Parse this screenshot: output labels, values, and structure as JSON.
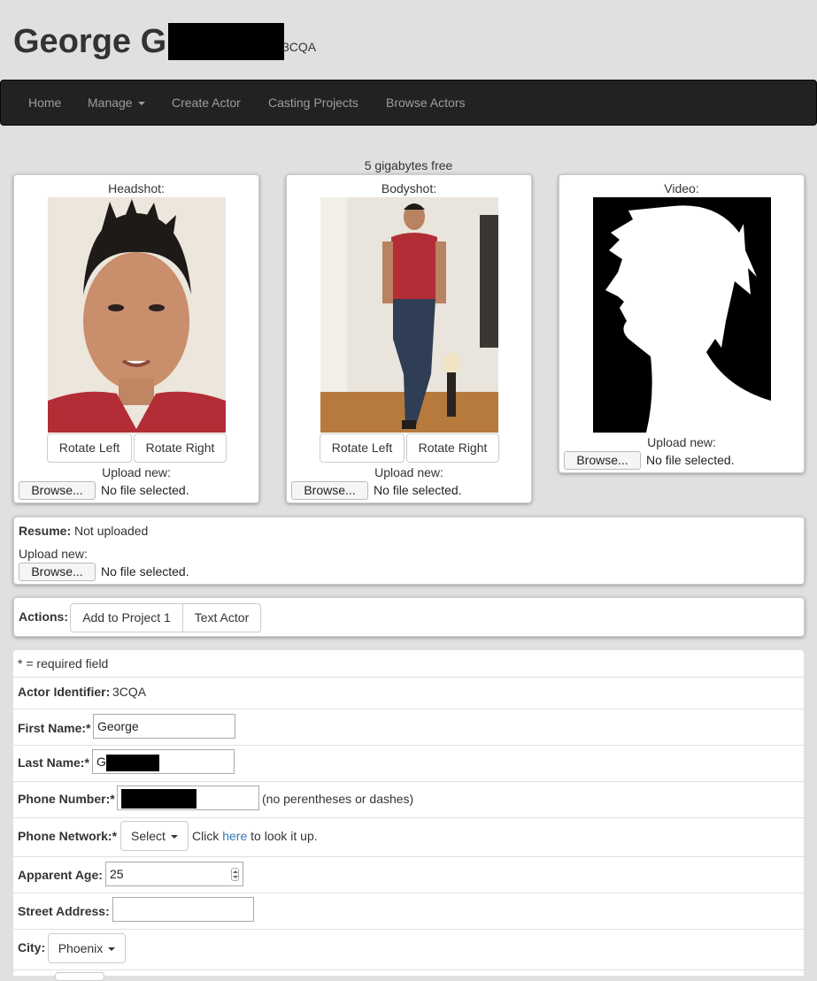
{
  "header": {
    "title_visible": "George G",
    "actor_code": "3CQA"
  },
  "nav": {
    "items": [
      {
        "label": "Home"
      },
      {
        "label": "Manage"
      },
      {
        "label": "Create Actor"
      },
      {
        "label": "Casting Projects"
      },
      {
        "label": "Browse Actors"
      }
    ]
  },
  "storage_text": "5 gigabytes free",
  "media": {
    "headshot": {
      "label": "Headshot:",
      "rotate_left": "Rotate Left",
      "rotate_right": "Rotate Right",
      "upload_label": "Upload new:",
      "browse": "Browse...",
      "file_status": "No file selected."
    },
    "bodyshot": {
      "label": "Bodyshot:",
      "rotate_left": "Rotate Left",
      "rotate_right": "Rotate Right",
      "upload_label": "Upload new:",
      "browse": "Browse...",
      "file_status": "No file selected."
    },
    "video": {
      "label": "Video:",
      "upload_label": "Upload new:",
      "browse": "Browse...",
      "file_status": "No file selected."
    }
  },
  "resume": {
    "label": "Resume:",
    "status": "Not uploaded",
    "upload_label": "Upload new:",
    "browse": "Browse...",
    "file_status": "No file selected."
  },
  "actions": {
    "label": "Actions:",
    "add_to_project": "Add to Project 1",
    "text_actor": "Text Actor"
  },
  "form": {
    "required_note": "* = required field",
    "identifier_label": "Actor Identifier:",
    "identifier_value": "3CQA",
    "first_name_label": "First Name:*",
    "first_name_value": "George",
    "last_name_label": "Last Name:*",
    "last_name_value": "G",
    "phone_label": "Phone Number:*",
    "phone_hint": "(no perentheses or dashes)",
    "network_label": "Phone Network:*",
    "network_select": "Select",
    "network_hint_pre": "Click",
    "network_hint_link": "here",
    "network_hint_post": "to look it up.",
    "age_label": "Apparent Age:",
    "age_value": "25",
    "address_label": "Street Address:",
    "address_value": "",
    "city_label": "City:",
    "city_value": "Phoenix"
  }
}
